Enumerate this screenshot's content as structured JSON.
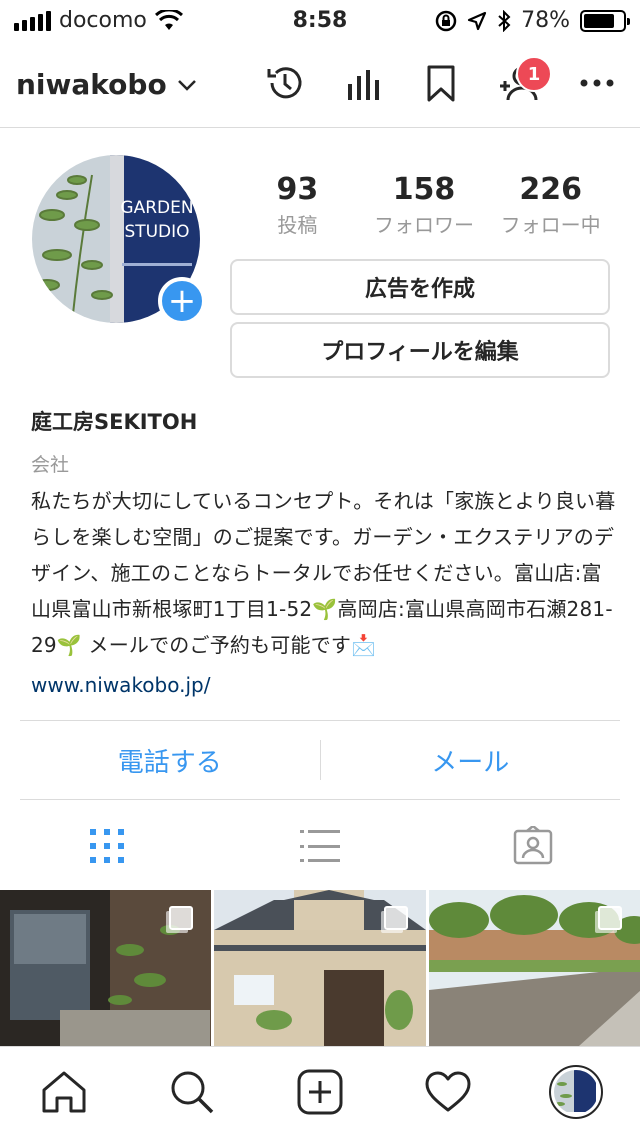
{
  "status_bar": {
    "carrier": "docomo",
    "time": "8:58",
    "battery": "78%",
    "battery_level": 0.78
  },
  "header": {
    "username": "niwakobo",
    "notification_count": "1"
  },
  "profile": {
    "stats": [
      {
        "value": "93",
        "label": "投稿"
      },
      {
        "value": "158",
        "label": "フォロワー"
      },
      {
        "value": "226",
        "label": "フォロー中"
      }
    ],
    "create_ad_label": "広告を作成",
    "edit_profile_label": "プロフィールを編集",
    "avatar_text_line1": "GARDEN",
    "avatar_text_line2": "STUDIO",
    "name": "庭工房SEKITOH",
    "category": "会社",
    "bio": "私たちが大切にしているコンセプト。それは「家族とより良い暮らしを楽しむ空間」のご提案です。ガーデン・エクステリアのデザイン、施工のことならトータルでお任せください。富山店:富山県富山市新根塚町1丁目1-52🌱高岡店:富山県高岡市石瀬281-29🌱 メールでのご予約も可能です📩",
    "website": "www.niwakobo.jp/"
  },
  "contact": {
    "call_label": "電話する",
    "email_label": "メール"
  },
  "colors": {
    "accent": "#3897f0",
    "badge": "#ed4956",
    "link": "#003569"
  }
}
